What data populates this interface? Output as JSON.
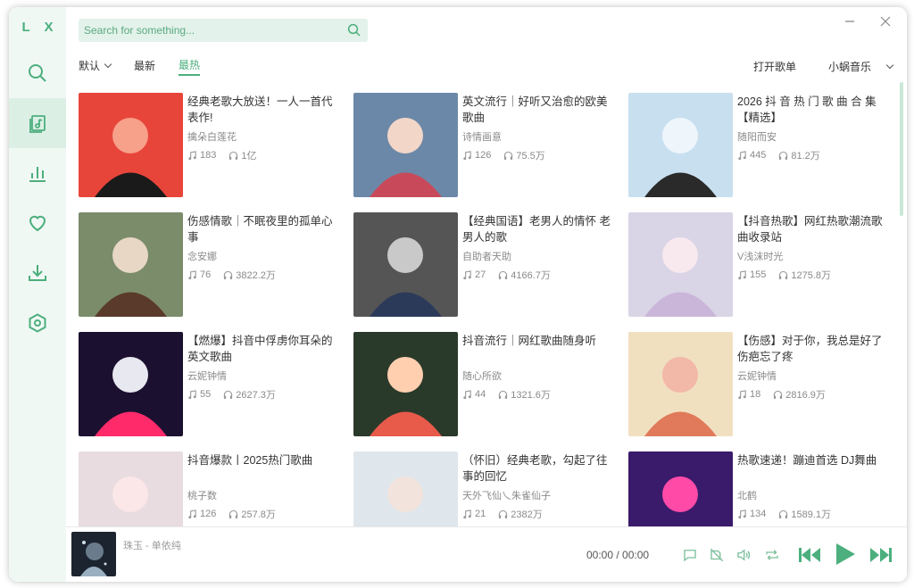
{
  "app": {
    "logo": "L X"
  },
  "sidebar": {
    "items": [
      {
        "name": "search-icon"
      },
      {
        "name": "songlist-icon",
        "active": true
      },
      {
        "name": "leaderboard-icon"
      },
      {
        "name": "heart-icon"
      },
      {
        "name": "download-icon"
      },
      {
        "name": "settings-icon"
      }
    ]
  },
  "search": {
    "placeholder": "Search for something..."
  },
  "sort": {
    "default_label": "默认",
    "newest_label": "最新",
    "hottest_label": "最热"
  },
  "header": {
    "open_playlist": "打开歌单",
    "source": "小蜗音乐"
  },
  "playlists": [
    {
      "title": "经典老歌大放送！一人一首代表作!",
      "author": "擒朵白莲花",
      "songs": "183",
      "plays": "1亿"
    },
    {
      "title": "英文流行｜好听又治愈的欧美歌曲",
      "author": "诗情画意",
      "songs": "126",
      "plays": "75.5万"
    },
    {
      "title": "2026 抖 音 热 门 歌 曲 合 集【精选】",
      "author": "随阳而安",
      "songs": "445",
      "plays": "81.2万"
    },
    {
      "title": "伤感情歌｜不眠夜里的孤单心事",
      "author": "念安娜",
      "songs": "76",
      "plays": "3822.2万"
    },
    {
      "title": "【经典国语】老男人的情怀 老男人的歌",
      "author": "自助者天助",
      "songs": "27",
      "plays": "4166.7万"
    },
    {
      "title": "【抖音热歌】网红热歌潮流歌曲收录站",
      "author": "V浅沫时光",
      "songs": "155",
      "plays": "1275.8万"
    },
    {
      "title": "【燃爆】抖音中俘虏你耳朵的英文歌曲",
      "author": "云妮钟情",
      "songs": "55",
      "plays": "2627.3万"
    },
    {
      "title": "抖音流行｜网红歌曲随身听",
      "author": "随心所欲",
      "songs": "44",
      "plays": "1321.6万"
    },
    {
      "title": "【伤感】对于你，我总是好了伤疤忘了疼",
      "author": "云妮钟情",
      "songs": "18",
      "plays": "2816.9万"
    },
    {
      "title": "抖音爆款丨2025热门歌曲",
      "author": "桃子数",
      "songs": "126",
      "plays": "257.8万"
    },
    {
      "title": "（怀旧）经典老歌，勾起了往事的回忆",
      "author": "天外飞仙乀朱雀仙子",
      "songs": "21",
      "plays": "2382万"
    },
    {
      "title": "热歌速递！蹦迪首选 DJ舞曲",
      "author": "北鹤",
      "songs": "134",
      "plays": "1589.1万"
    }
  ],
  "player": {
    "title": "珠玉 - 单依纯",
    "time": "00:00 / 00:00"
  },
  "colors": {
    "accent": "#4caf7d",
    "sidebar_bg": "#f0f8f4",
    "search_bg": "#e3f2ea"
  }
}
